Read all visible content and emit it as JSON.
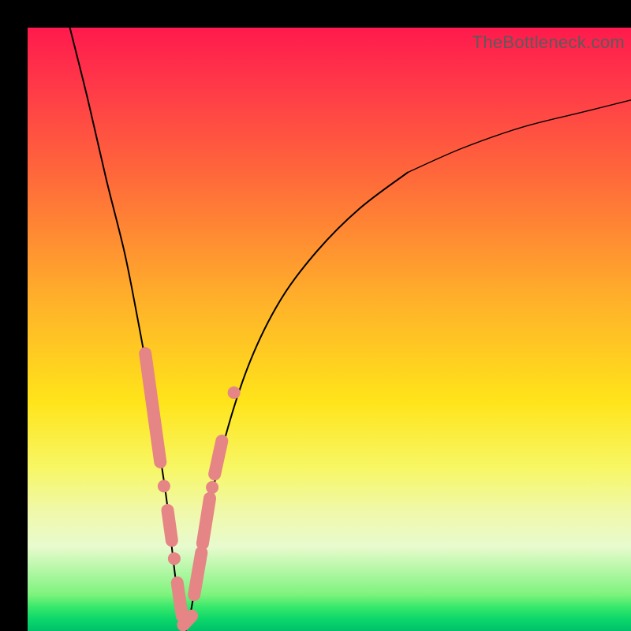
{
  "watermark": "TheBottleneck.com",
  "colors": {
    "marker": "#e58585",
    "curve": "#000000",
    "gradient_top": "#ff1a4d",
    "gradient_bottom": "#00c06a"
  },
  "chart_data": {
    "type": "line",
    "title": "",
    "xlabel": "",
    "ylabel": "",
    "xlim": [
      0,
      100
    ],
    "ylim": [
      0,
      100
    ],
    "grid": false,
    "legend": false,
    "series": [
      {
        "name": "bottleneck-curve",
        "x": [
          7,
          10,
          13,
          16,
          18,
          20,
          21.5,
          23,
          24,
          25,
          26,
          27,
          28,
          30,
          33,
          37,
          42,
          48,
          55,
          63,
          72,
          82,
          92,
          100
        ],
        "values": [
          100,
          88,
          75,
          63,
          53,
          42,
          32,
          22,
          13,
          5,
          0,
          3,
          9,
          20,
          33,
          45,
          55,
          63,
          70,
          76,
          80,
          83.5,
          86,
          88
        ]
      }
    ],
    "markers": [
      {
        "shape": "pill",
        "x": [
          19.5,
          22.0
        ],
        "y": [
          46.0,
          28.0
        ]
      },
      {
        "shape": "dot",
        "cx": 22.6,
        "cy": 24.0
      },
      {
        "shape": "pill",
        "x": [
          23.2,
          23.9
        ],
        "y": [
          20.0,
          15.0
        ]
      },
      {
        "shape": "dot",
        "cx": 24.3,
        "cy": 12.0
      },
      {
        "shape": "pill",
        "x": [
          24.8,
          25.6
        ],
        "y": [
          8.0,
          2.5
        ]
      },
      {
        "shape": "pill",
        "x": [
          25.8,
          27.2
        ],
        "y": [
          1.0,
          2.5
        ]
      },
      {
        "shape": "pill",
        "x": [
          27.6,
          28.8
        ],
        "y": [
          6.0,
          13.0
        ]
      },
      {
        "shape": "pill",
        "x": [
          29.0,
          30.2
        ],
        "y": [
          14.5,
          22.0
        ]
      },
      {
        "shape": "dot",
        "cx": 30.6,
        "cy": 23.8
      },
      {
        "shape": "pill",
        "x": [
          31.0,
          32.2
        ],
        "y": [
          26.0,
          31.5
        ]
      },
      {
        "shape": "dot",
        "cx": 34.2,
        "cy": 39.5
      }
    ]
  }
}
